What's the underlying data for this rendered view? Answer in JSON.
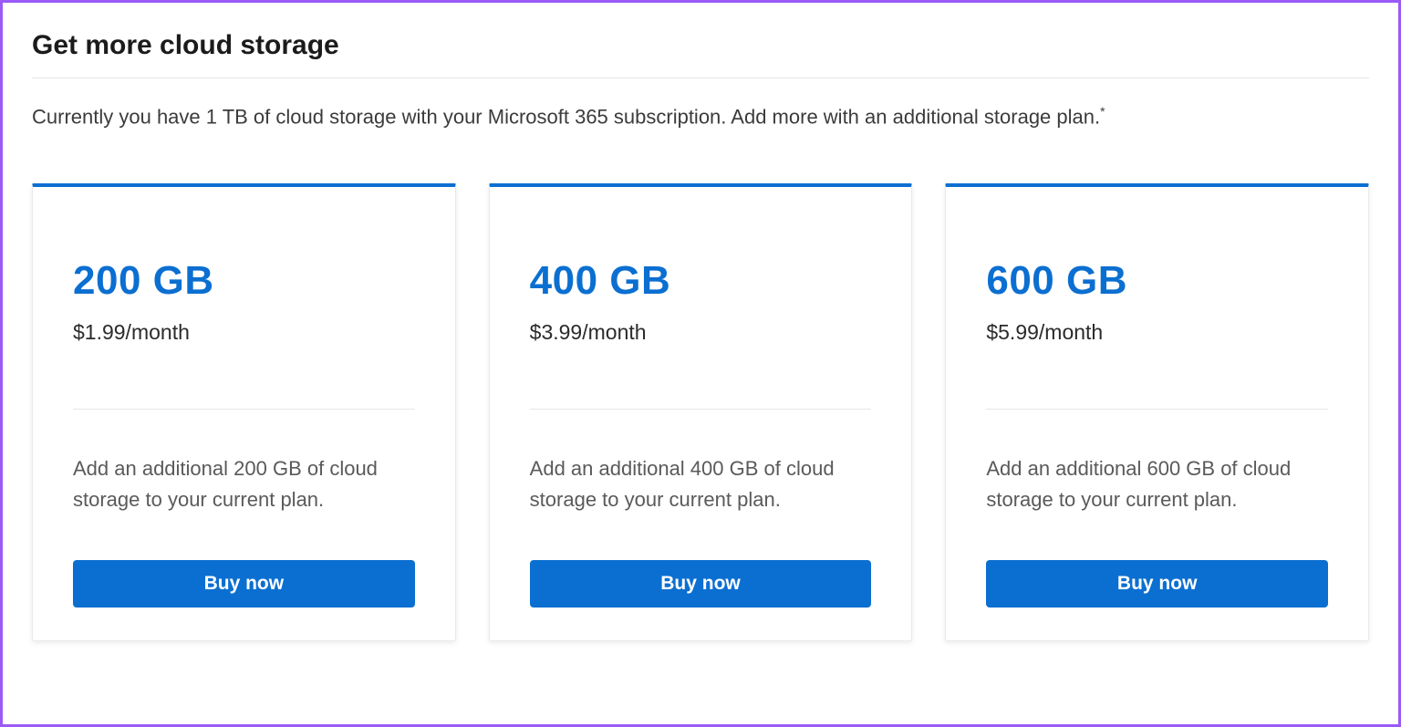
{
  "header": {
    "title": "Get more cloud storage",
    "subtitle": "Currently you have 1 TB of cloud storage with your Microsoft 365 subscription. Add more with an additional storage plan.",
    "footnote_marker": "*"
  },
  "plans": [
    {
      "size": "200 GB",
      "price": "$1.99/month",
      "description": "Add an additional 200 GB of cloud storage to your current plan.",
      "cta": "Buy now"
    },
    {
      "size": "400 GB",
      "price": "$3.99/month",
      "description": "Add an additional 400 GB of cloud storage to your current plan.",
      "cta": "Buy now"
    },
    {
      "size": "600 GB",
      "price": "$5.99/month",
      "description": "Add an additional 600 GB of cloud storage to your current plan.",
      "cta": "Buy now"
    }
  ]
}
